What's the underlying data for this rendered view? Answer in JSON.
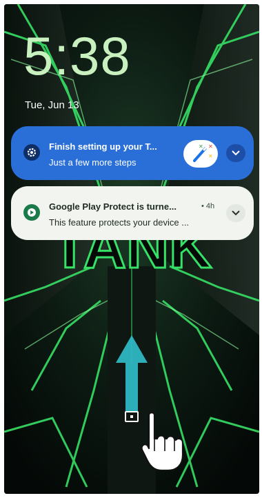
{
  "lock_screen": {
    "time": "5:38",
    "date": "Tue, Jun 13"
  },
  "notifications": [
    {
      "title": "Finish setting up your T...",
      "text": "Just a few more steps",
      "icon": "settings-gear-icon",
      "accent": "#2a6fd8"
    },
    {
      "title": "Google Play Protect is turne...",
      "time": "• 4h",
      "text": "This feature protects your device ...",
      "icon": "play-protect-icon",
      "accent": "#f2f5ef"
    }
  ],
  "gesture_hint": {
    "icon": "swipe-up-arrow-icon",
    "hand_icon": "tap-hand-icon"
  },
  "wallpaper": {
    "label": "TANK",
    "accent": "#2bd35a"
  }
}
